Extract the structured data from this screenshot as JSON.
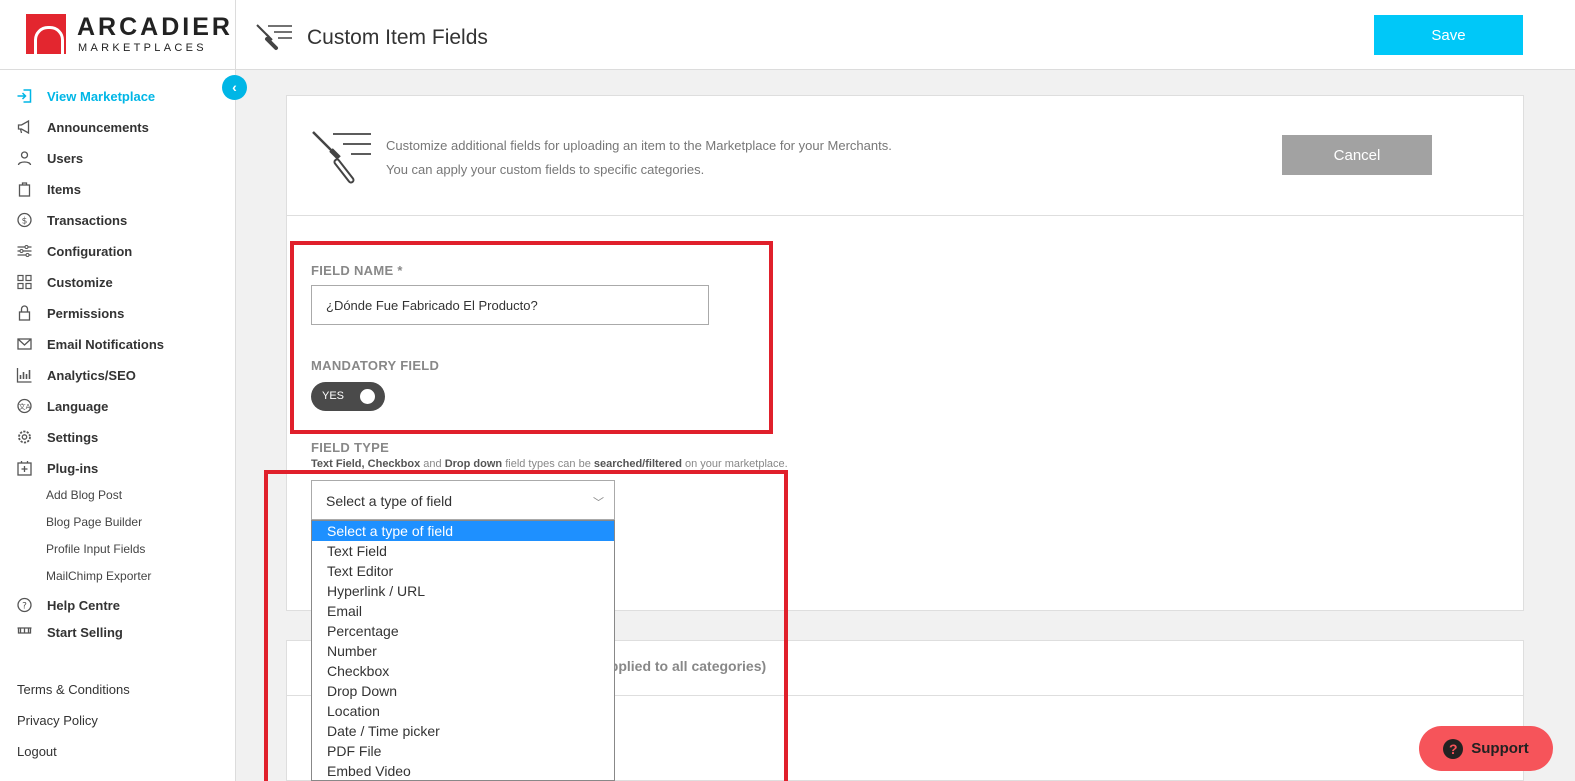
{
  "brand": {
    "name": "ARCADIER",
    "tagline": "MARKETPLACES",
    "color": "#e3262f"
  },
  "header": {
    "title": "Custom Item Fields",
    "save_label": "Save",
    "accent": "#00c8f8"
  },
  "sidebar": {
    "items": [
      {
        "label": "View Marketplace",
        "icon": "login-icon",
        "active": true
      },
      {
        "label": "Announcements",
        "icon": "megaphone-icon"
      },
      {
        "label": "Users",
        "icon": "user-icon"
      },
      {
        "label": "Items",
        "icon": "bag-icon"
      },
      {
        "label": "Transactions",
        "icon": "dollar-icon"
      },
      {
        "label": "Configuration",
        "icon": "sliders-icon"
      },
      {
        "label": "Customize",
        "icon": "grid-icon"
      },
      {
        "label": "Permissions",
        "icon": "lock-icon"
      },
      {
        "label": "Email Notifications",
        "icon": "mail-icon"
      },
      {
        "label": "Analytics/SEO",
        "icon": "bar-chart-icon"
      },
      {
        "label": "Language",
        "icon": "translate-icon"
      },
      {
        "label": "Settings",
        "icon": "gear-icon"
      },
      {
        "label": "Plug-ins",
        "icon": "plugin-icon"
      }
    ],
    "plugins": [
      "Add Blog Post",
      "Blog Page Builder",
      "Profile Input Fields",
      "MailChimp Exporter"
    ],
    "more_items": [
      {
        "label": "Help Centre",
        "icon": "help-icon"
      },
      {
        "label": "Start Selling",
        "icon": "store-icon"
      }
    ],
    "footer": [
      "Terms & Conditions",
      "Privacy Policy",
      "Logout"
    ]
  },
  "intro": {
    "line1": "Customize additional fields for uploading an item to the Marketplace for your Merchants.",
    "line2": "You can apply your custom fields to specific categories.",
    "cancel_label": "Cancel"
  },
  "form": {
    "field_name_label": "FIELD NAME *",
    "field_name_value": "¿Dónde Fue Fabricado El Producto?",
    "mandatory_label": "MANDATORY FIELD",
    "mandatory_value": "YES",
    "field_type_label": "FIELD TYPE",
    "help": {
      "t1": "Text Field,",
      "t2": " Checkbox",
      "t3": " and ",
      "t4": "Drop down",
      "t5": " field types can be ",
      "t6": "searched/filtered",
      "t7": " on your marketplace."
    },
    "select_value": "Select a type of field",
    "options": [
      "Select a type of field",
      "Text Field",
      "Text Editor",
      "Hyperlink / URL",
      "Email",
      "Percentage",
      "Number",
      "Checkbox",
      "Drop Down",
      "Location",
      "Date / Time picker",
      "PDF File",
      "Embed Video"
    ],
    "selected_index": 0
  },
  "categories_text": "applied to all categories)",
  "support": {
    "label": "Support",
    "color": "#f6545a"
  }
}
